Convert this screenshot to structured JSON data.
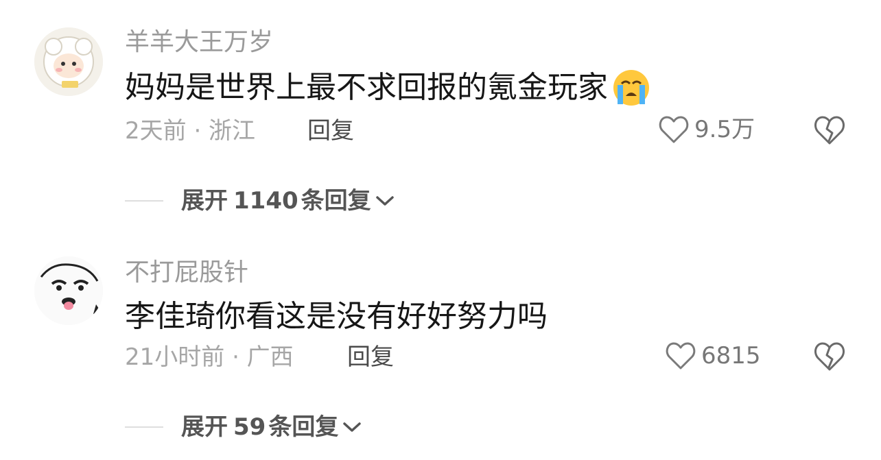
{
  "comments": [
    {
      "username": "羊羊大王万岁",
      "text": "妈妈是世界上最不求回报的氪金玩家",
      "emoji": "loudly-crying-face",
      "meta": "2天前 · 浙江",
      "reply_label": "回复",
      "likes": "9.5万",
      "expand_prefix": "展开",
      "expand_count": "1140",
      "expand_suffix": "条回复"
    },
    {
      "username": "不打屁股针",
      "text": "李佳琦你看这是没有好好努力吗",
      "meta": "21小时前 · 广西",
      "reply_label": "回复",
      "likes": "6815",
      "expand_prefix": "展开",
      "expand_count": "59",
      "expand_suffix": "条回复"
    }
  ],
  "icons": {
    "like": "heart-outline-icon",
    "dislike": "broken-heart-icon",
    "expand": "chevron-down-icon"
  },
  "colors": {
    "username": "#9a9a9a",
    "text": "#161616",
    "meta": "#a6a6a6",
    "icon": "#777777"
  }
}
